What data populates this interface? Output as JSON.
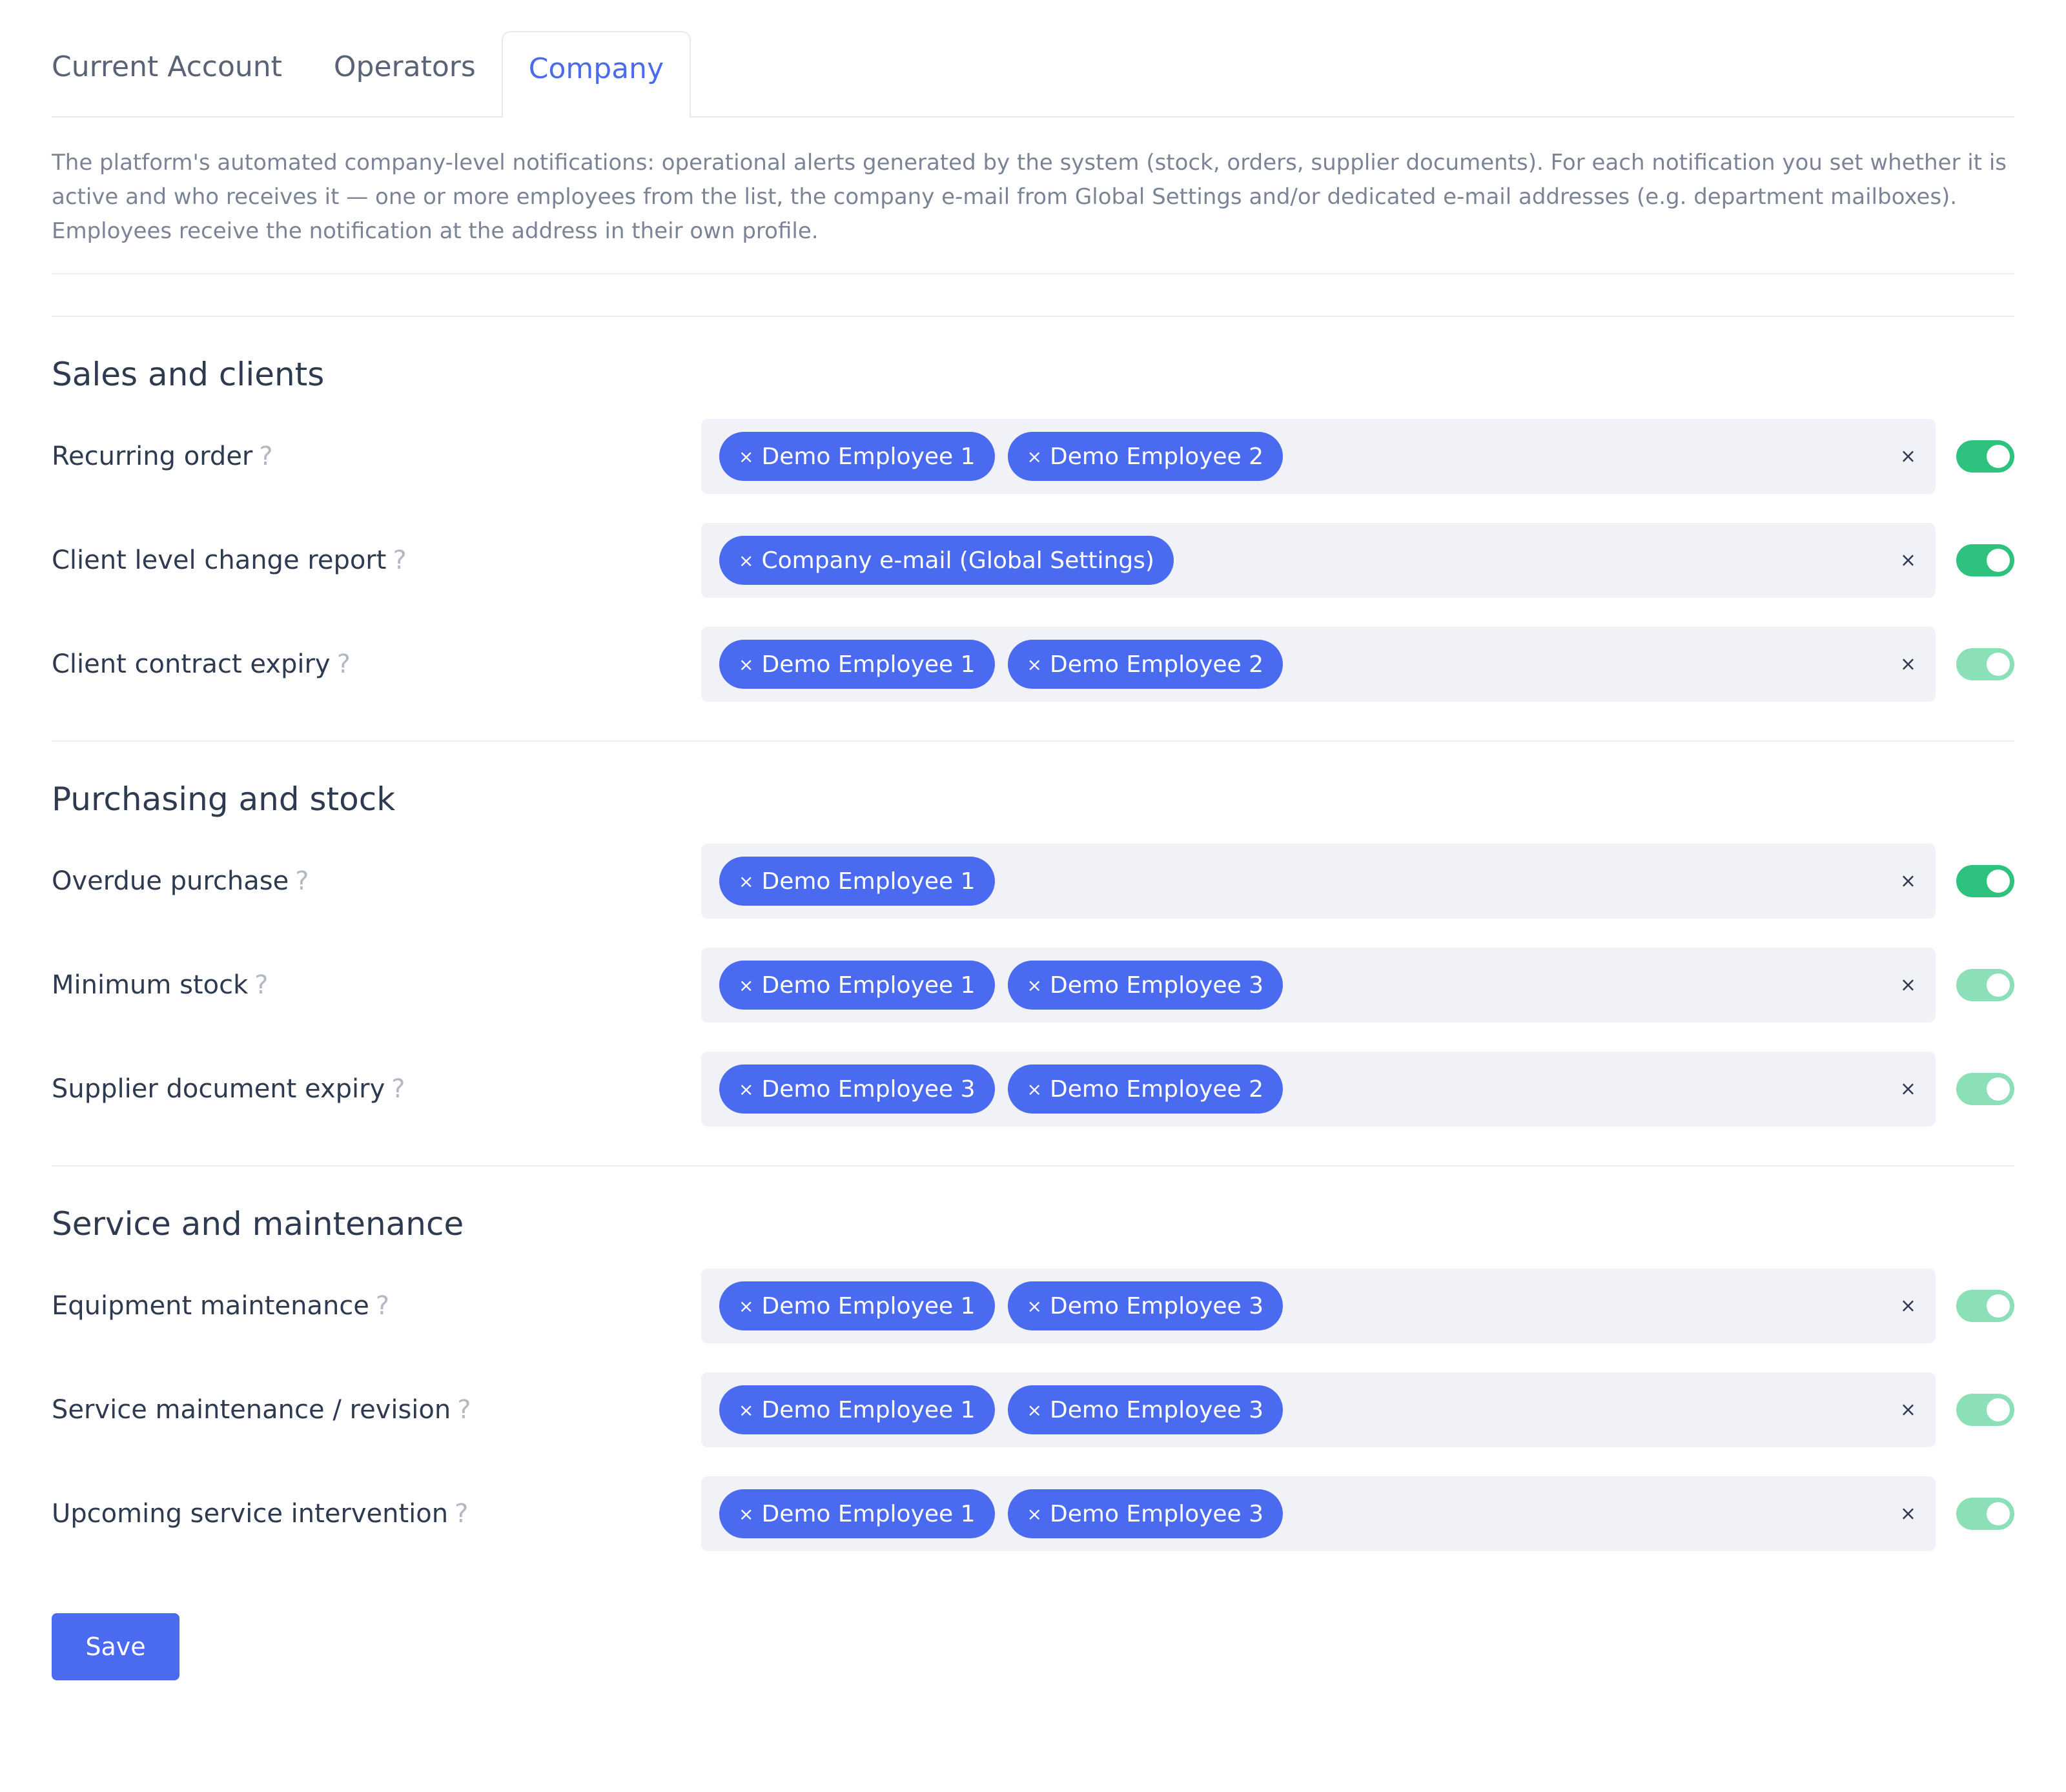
{
  "tabs": [
    {
      "label": "Current Account",
      "active": false
    },
    {
      "label": "Operators",
      "active": false
    },
    {
      "label": "Company",
      "active": true
    }
  ],
  "intro": "The platform's automated company-level notifications: operational alerts generated by the system (stock, orders, supplier documents). For each notification you set whether it is active and who receives it — one or more employees from the list, the company e-mail from Global Settings and/or dedicated e-mail addresses (e.g. department mailboxes). Employees receive the notification at the address in their own profile.",
  "help_glyph": "?",
  "chip_remove_glyph": "×",
  "clear_glyph": "×",
  "colors": {
    "accent": "#4a6bf0",
    "toggle_on": "#2ec27e",
    "toggle_soft": "#8be0b8",
    "field_bg": "#f0f2f7"
  },
  "sections": [
    {
      "title": "Sales and clients",
      "rows": [
        {
          "label": "Recurring order",
          "recipients": [
            "Demo Employee 1",
            "Demo Employee 2"
          ],
          "enabled": true,
          "toggle_style": "on"
        },
        {
          "label": "Client level change report",
          "recipients": [
            "Company e-mail (Global Settings)"
          ],
          "enabled": true,
          "toggle_style": "on"
        },
        {
          "label": "Client contract expiry",
          "recipients": [
            "Demo Employee 1",
            "Demo Employee 2"
          ],
          "enabled": true,
          "toggle_style": "soft"
        }
      ]
    },
    {
      "title": "Purchasing and stock",
      "rows": [
        {
          "label": "Overdue purchase",
          "recipients": [
            "Demo Employee 1"
          ],
          "enabled": true,
          "toggle_style": "on"
        },
        {
          "label": "Minimum stock",
          "recipients": [
            "Demo Employee 1",
            "Demo Employee 3"
          ],
          "enabled": true,
          "toggle_style": "soft"
        },
        {
          "label": "Supplier document expiry",
          "recipients": [
            "Demo Employee 3",
            "Demo Employee 2"
          ],
          "enabled": true,
          "toggle_style": "soft"
        }
      ]
    },
    {
      "title": "Service and maintenance",
      "rows": [
        {
          "label": "Equipment maintenance",
          "recipients": [
            "Demo Employee 1",
            "Demo Employee 3"
          ],
          "enabled": true,
          "toggle_style": "soft"
        },
        {
          "label": "Service maintenance / revision",
          "recipients": [
            "Demo Employee 1",
            "Demo Employee 3"
          ],
          "enabled": true,
          "toggle_style": "soft"
        },
        {
          "label": "Upcoming service intervention",
          "recipients": [
            "Demo Employee 1",
            "Demo Employee 3"
          ],
          "enabled": true,
          "toggle_style": "soft"
        }
      ]
    }
  ],
  "save_label": "Save"
}
